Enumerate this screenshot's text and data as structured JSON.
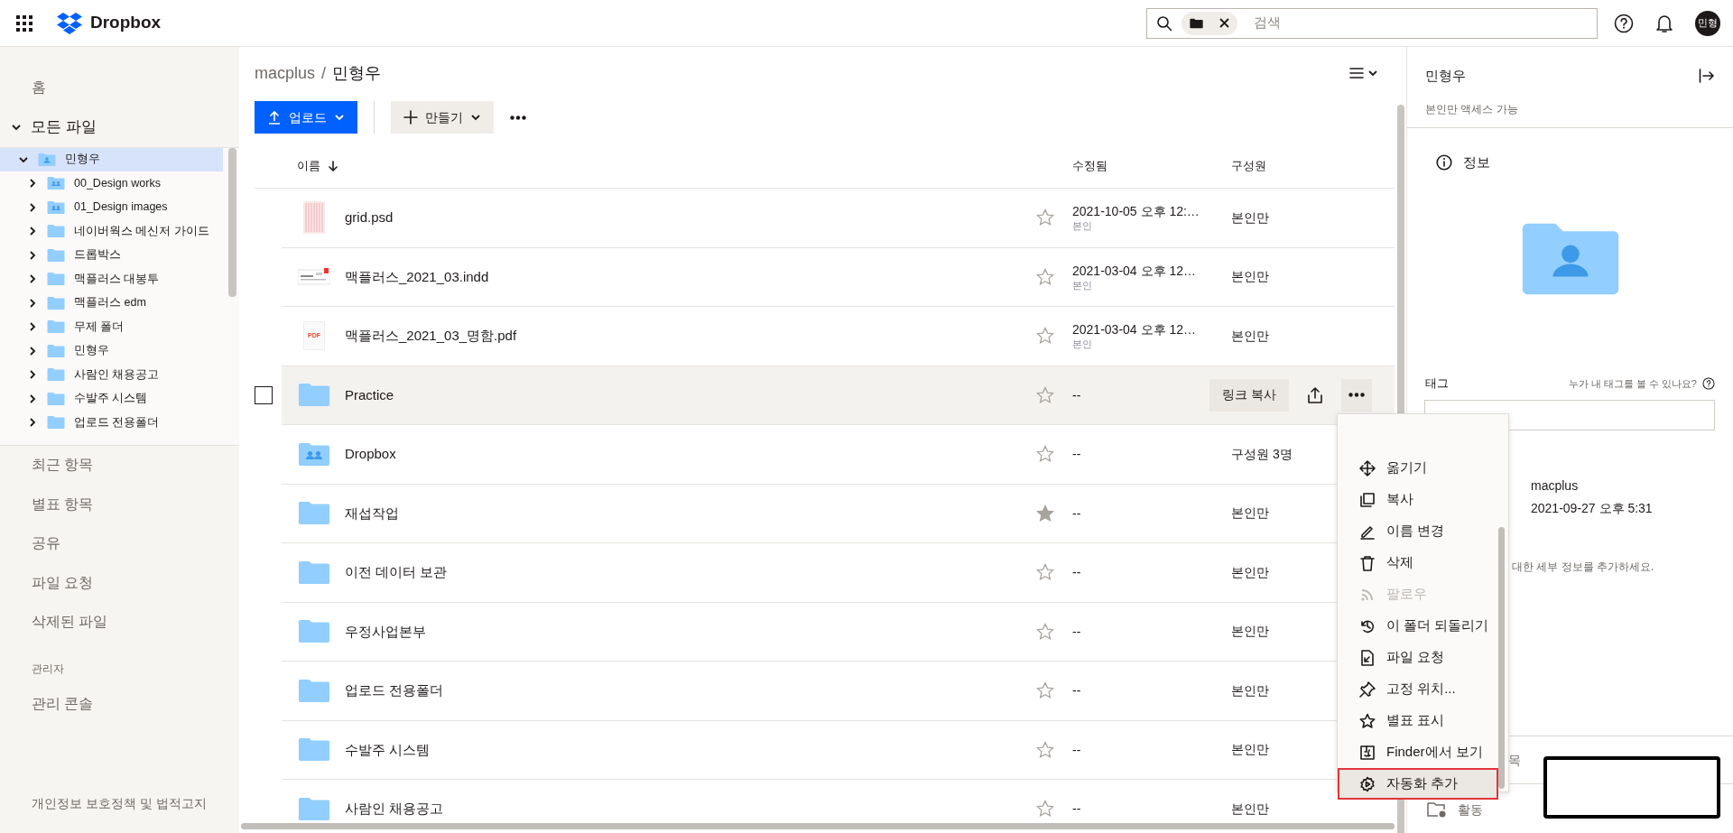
{
  "header": {
    "app_name": "Dropbox",
    "search": {
      "placeholder": "검색"
    },
    "avatar": "민형"
  },
  "sidebar": {
    "home": "홈",
    "all_files": {
      "label": "모든 파일",
      "expanded": true,
      "tree": [
        {
          "label": "민형우",
          "kind": "personal",
          "expanded": true,
          "selected": true,
          "children": [
            {
              "label": "00_Design works",
              "kind": "shared",
              "expanded": false,
              "selected": false
            },
            {
              "label": "01_Design images",
              "kind": "shared",
              "expanded": false,
              "selected": false
            },
            {
              "label": "네이버웍스 메신저 가이드",
              "kind": "folder",
              "expanded": false,
              "selected": false
            },
            {
              "label": "드롭박스",
              "kind": "folder",
              "expanded": false,
              "selected": false
            },
            {
              "label": "맥플러스 대봉투",
              "kind": "folder",
              "expanded": false,
              "selected": false
            },
            {
              "label": "맥플러스 edm",
              "kind": "folder",
              "expanded": false,
              "selected": false
            },
            {
              "label": "무제 폴더",
              "kind": "folder",
              "expanded": false,
              "selected": false
            },
            {
              "label": "민형우",
              "kind": "folder",
              "expanded": false,
              "selected": false
            },
            {
              "label": "사람인 채용공고",
              "kind": "folder",
              "expanded": false,
              "selected": false
            },
            {
              "label": "수발주 시스템",
              "kind": "folder",
              "expanded": false,
              "selected": false
            },
            {
              "label": "업로드 전용폴더",
              "kind": "folder",
              "expanded": false,
              "selected": false
            }
          ]
        }
      ]
    },
    "nav_items": [
      "최근 항목",
      "별표 항목",
      "공유",
      "파일 요청",
      "삭제된 파일"
    ],
    "admin_heading": "관리자",
    "admin_items": [
      "관리 콘솔"
    ],
    "footer_link": "개인정보 보호정책 및 법적고지"
  },
  "main": {
    "breadcrumb": [
      "macplus",
      "민형우"
    ],
    "breadcrumb_separator": "/",
    "toolbar": {
      "upload": "업로드",
      "create": "만들기"
    },
    "columns": [
      "이름",
      "수정됨",
      "구성원"
    ],
    "rows": [
      {
        "name": "grid.psd",
        "kind": "image",
        "starred": false,
        "highlighted": false,
        "checked": false,
        "modified": "2021-10-05 오후 12:…",
        "modified_by": "본인",
        "members": "본인만"
      },
      {
        "name": "맥플러스_2021_03.indd",
        "kind": "document",
        "starred": false,
        "highlighted": false,
        "checked": false,
        "modified": "2021-03-04 오후 12…",
        "modified_by": "본인",
        "members": "본인만"
      },
      {
        "name": "맥플러스_2021_03_명함.pdf",
        "kind": "pdf",
        "icon_label": "PDF",
        "starred": false,
        "highlighted": false,
        "checked": false,
        "modified": "2021-03-04 오후 12…",
        "modified_by": "본인",
        "members": "본인만"
      },
      {
        "name": "Practice",
        "kind": "folder",
        "starred": false,
        "highlighted": true,
        "checked": false,
        "modified": "--",
        "action": "링크 복사"
      },
      {
        "name": "Dropbox",
        "kind": "shared",
        "starred": false,
        "highlighted": false,
        "checked": false,
        "modified": "--",
        "members": "구성원 3명"
      },
      {
        "name": "재섭작업",
        "kind": "folder",
        "starred": true,
        "highlighted": false,
        "checked": false,
        "modified": "--",
        "members": "본인만"
      },
      {
        "name": "이전 데이터 보관",
        "kind": "folder",
        "starred": false,
        "highlighted": false,
        "checked": false,
        "modified": "--",
        "members": "본인만"
      },
      {
        "name": "우정사업본부",
        "kind": "folder",
        "starred": false,
        "highlighted": false,
        "checked": false,
        "modified": "--",
        "members": "본인만"
      },
      {
        "name": "업로드 전용폴더",
        "kind": "folder",
        "starred": false,
        "highlighted": false,
        "checked": false,
        "modified": "--",
        "members": "본인만"
      },
      {
        "name": "수발주 시스템",
        "kind": "folder",
        "starred": false,
        "highlighted": false,
        "checked": false,
        "modified": "--",
        "members": "본인만"
      },
      {
        "name": "사람인 채용공고",
        "kind": "folder",
        "starred": false,
        "highlighted": false,
        "checked": false,
        "modified": "--",
        "members": "본인만"
      }
    ]
  },
  "context_menu": {
    "items": [
      {
        "label": "옮기기",
        "disabled": false,
        "selected": false
      },
      {
        "label": "복사",
        "disabled": false,
        "selected": false
      },
      {
        "label": "이름 변경",
        "disabled": false,
        "selected": false
      },
      {
        "label": "삭제",
        "disabled": false,
        "selected": false
      },
      {
        "label": "팔로우",
        "disabled": true,
        "selected": false
      },
      {
        "label": "이 폴더 되돌리기",
        "disabled": false,
        "selected": false
      },
      {
        "label": "파일 요청",
        "disabled": false,
        "selected": false
      },
      {
        "label": "고정 위치...",
        "disabled": false,
        "selected": false
      },
      {
        "label": "별표 표시",
        "disabled": false,
        "selected": false
      },
      {
        "label": "Finder에서 보기",
        "disabled": false,
        "selected": false
      },
      {
        "label": "자동화 추가",
        "disabled": false,
        "selected": true
      }
    ]
  },
  "details_panel": {
    "title": "민형우",
    "access": "본인만 액세스 가능",
    "section": "정보",
    "tags_label": "태그",
    "tags_help": "누가 내 태그를 볼 수 있나요?",
    "owner": "macplus",
    "date": "2021-09-27 오후 5:31",
    "hint": "대한 세부 정보를 추가하세요.",
    "section_fragment": "목",
    "activity": "활동"
  }
}
